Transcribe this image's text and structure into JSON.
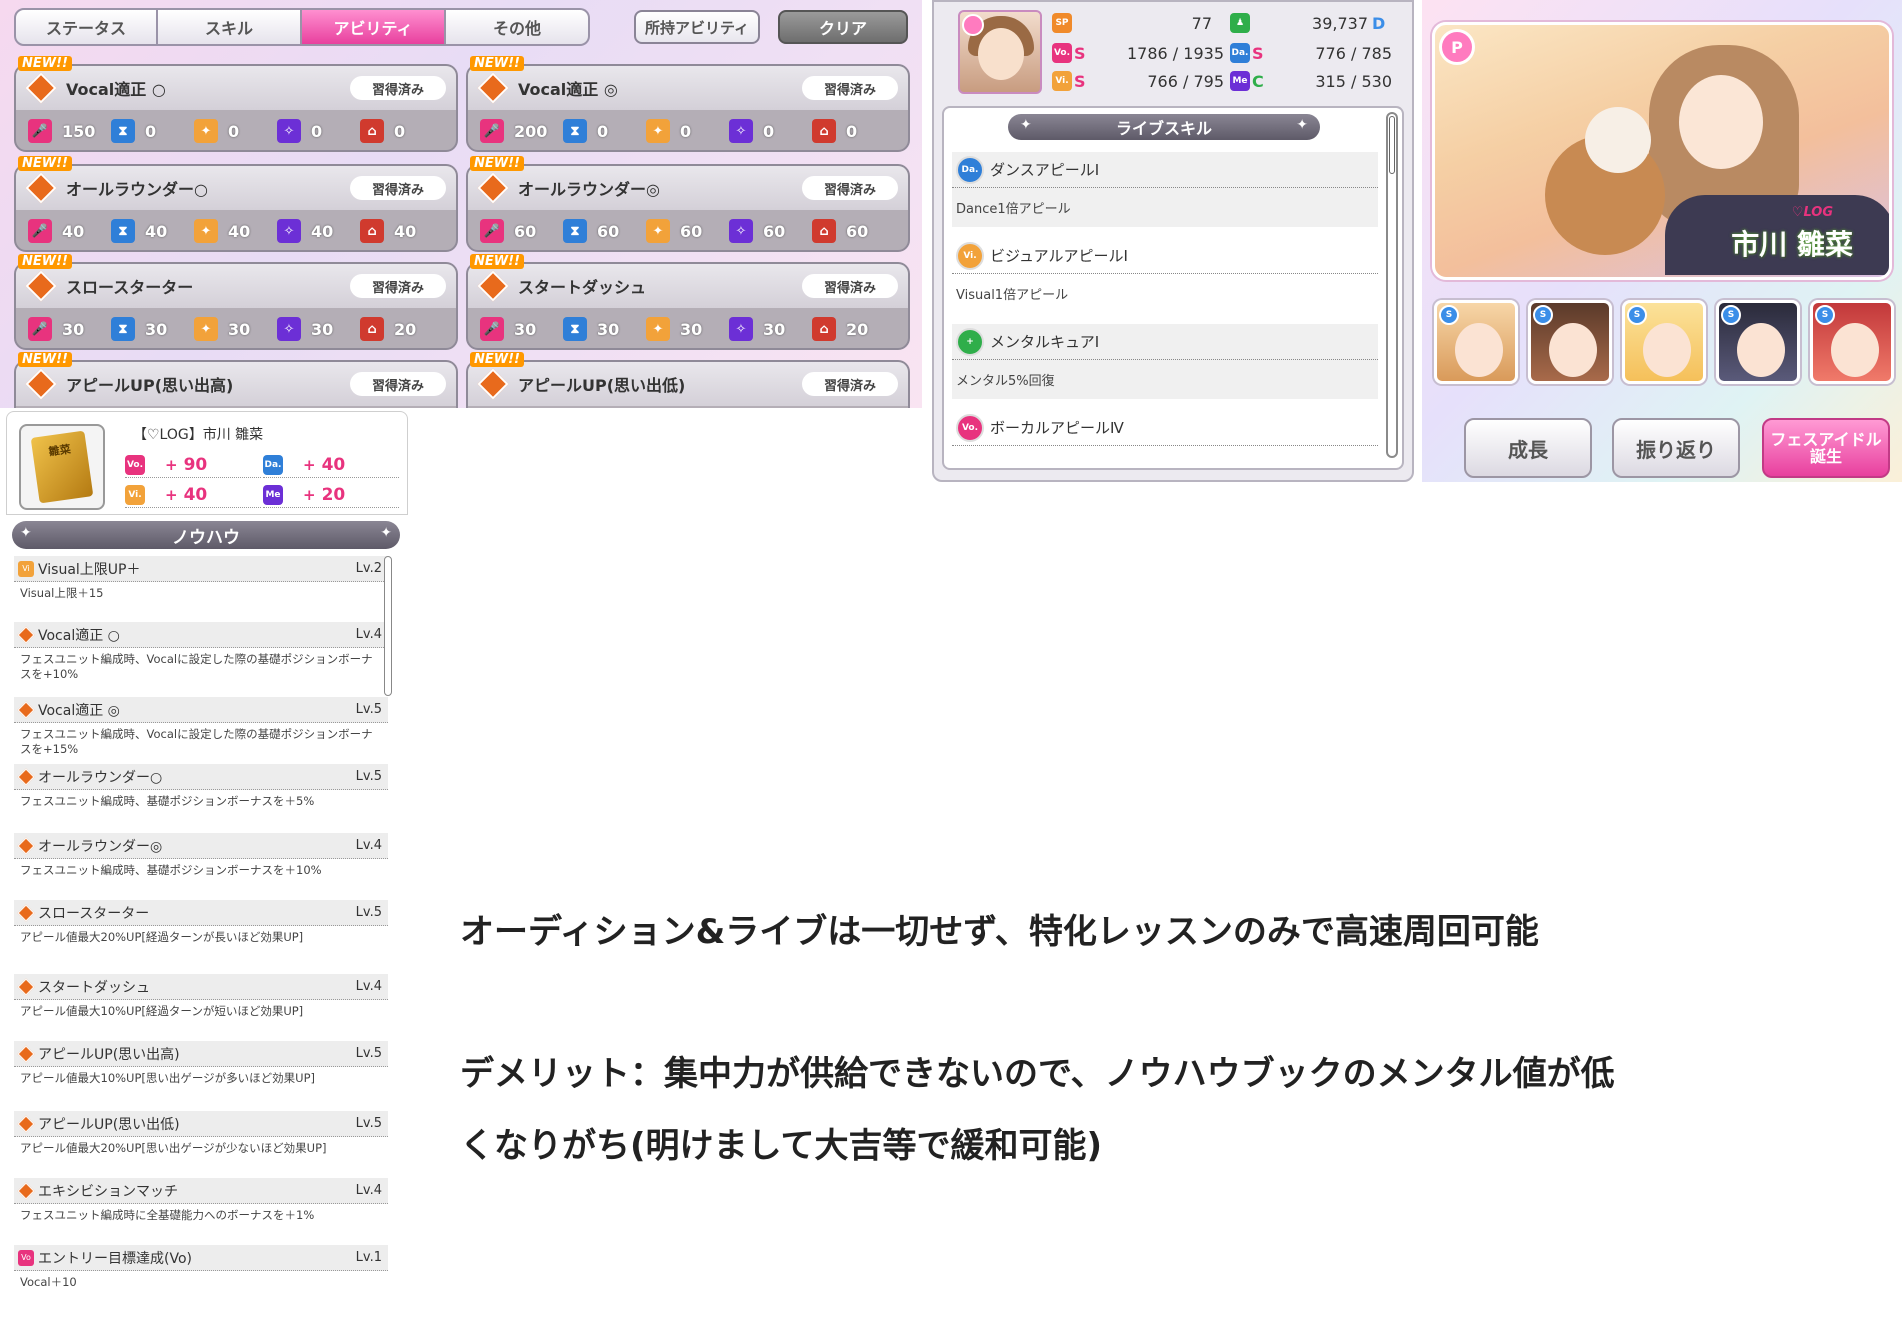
{
  "abilities_panel": {
    "tabs": [
      "ステータス",
      "スキル",
      "アビリティ",
      "その他"
    ],
    "active_tab": "アビリティ",
    "owned_button": "所持アビリティ",
    "clear_button": "クリア",
    "new_label": "NEW!!",
    "learned_label": "習得済み",
    "cards": [
      {
        "name": "Vocal適正 ○",
        "stats": [
          "150",
          "0",
          "0",
          "0",
          "0"
        ]
      },
      {
        "name": "Vocal適正 ◎",
        "stats": [
          "200",
          "0",
          "0",
          "0",
          "0"
        ]
      },
      {
        "name": "オールラウンダー○",
        "stats": [
          "40",
          "40",
          "40",
          "40",
          "40"
        ]
      },
      {
        "name": "オールラウンダー◎",
        "stats": [
          "60",
          "60",
          "60",
          "60",
          "60"
        ]
      },
      {
        "name": "スロースターター",
        "stats": [
          "30",
          "30",
          "30",
          "30",
          "20"
        ]
      },
      {
        "name": "スタートダッシュ",
        "stats": [
          "30",
          "30",
          "30",
          "30",
          "20"
        ]
      },
      {
        "name": "アピールUP(思い出高)",
        "stats": []
      },
      {
        "name": "アピールUP(思い出低)",
        "stats": []
      }
    ]
  },
  "book": {
    "title": "【♡LOG】市川 雛菜",
    "cover_text": "雛菜",
    "stats": {
      "vo": "40",
      "da": "90",
      "vi": "40",
      "me": "20"
    },
    "stats_display": {
      "vo": "90",
      "da": "40",
      "vi": "40",
      "me": "20"
    },
    "plus": "+",
    "header": "ノウハウ",
    "items": [
      {
        "name": "Visual上限UP＋",
        "lv": "Lv.2",
        "desc": "Visual上限＋15",
        "icon": "vi"
      },
      {
        "name": "Vocal適正 ○",
        "lv": "Lv.4",
        "desc": "フェスユニット編成時、Vocalに設定した際の基礎ポジションボーナスを+10%",
        "icon": "dia"
      },
      {
        "name": "Vocal適正 ◎",
        "lv": "Lv.5",
        "desc": "フェスユニット編成時、Vocalに設定した際の基礎ポジションボーナスを+15%",
        "icon": "dia"
      },
      {
        "name": "オールラウンダー○",
        "lv": "Lv.5",
        "desc": "フェスユニット編成時、基礎ポジションボーナスを＋5%",
        "icon": "dia"
      },
      {
        "name": "オールラウンダー◎",
        "lv": "Lv.4",
        "desc": "フェスユニット編成時、基礎ポジションボーナスを＋10%",
        "icon": "dia"
      },
      {
        "name": "スロースターター",
        "lv": "Lv.5",
        "desc": "アピール値最大20%UP[経過ターンが長いほど効果UP]",
        "icon": "dia"
      },
      {
        "name": "スタートダッシュ",
        "lv": "Lv.4",
        "desc": "アピール値最大10%UP[経過ターンが短いほど効果UP]",
        "icon": "dia"
      },
      {
        "name": "アピールUP(思い出高)",
        "lv": "Lv.5",
        "desc": "アピール値最大10%UP[思い出ゲージが多いほど効果UP]",
        "icon": "dia"
      },
      {
        "name": "アピールUP(思い出低)",
        "lv": "Lv.5",
        "desc": "アピール値最大20%UP[思い出ゲージが少ないほど効果UP]",
        "icon": "dia"
      },
      {
        "name": "エキシビションマッチ",
        "lv": "Lv.4",
        "desc": "フェスユニット編成時に全基礎能力へのボーナスを＋1%",
        "icon": "dia"
      },
      {
        "name": "エントリー目標達成(Vo)",
        "lv": "Lv.1",
        "desc": "Vocal＋10",
        "icon": "vo"
      }
    ]
  },
  "live": {
    "sp": "77",
    "fans": "39,737",
    "fan_rank": "D",
    "vo": "1786 / 1935",
    "vo_rank": "S",
    "da": "776 / 785",
    "da_rank": "S",
    "vi": "766 / 795",
    "vi_rank": "S",
    "me": "315 / 530",
    "me_rank": "C",
    "header": "ライブスキル",
    "skills": [
      {
        "name": "ダンスアピールⅠ",
        "desc": "Dance1倍アピール",
        "icon": "Da."
      },
      {
        "name": "ビジュアルアピールⅠ",
        "desc": "Visual1倍アピール",
        "icon": "Vi."
      },
      {
        "name": "メンタルキュアⅠ",
        "desc": "メンタル5%回復",
        "icon": "+"
      },
      {
        "name": "ボーカルアピールⅣ",
        "desc": "",
        "icon": "Vo."
      }
    ]
  },
  "right": {
    "idol_name": "市川 雛菜",
    "idol_sub": "♡LOG",
    "support_badge": "S",
    "buttons": [
      "成長",
      "振り返り",
      "フェスアイドル誕生"
    ]
  },
  "caption": {
    "line1": "オーディション&ライブは一切せず、特化レッスンのみで高速周回可能",
    "line2": "デメリット：集中力が供給できないので、ノウハウブックのメンタル値が低",
    "line3": "くなりがち(明けまして大吉等で緩和可能)"
  }
}
